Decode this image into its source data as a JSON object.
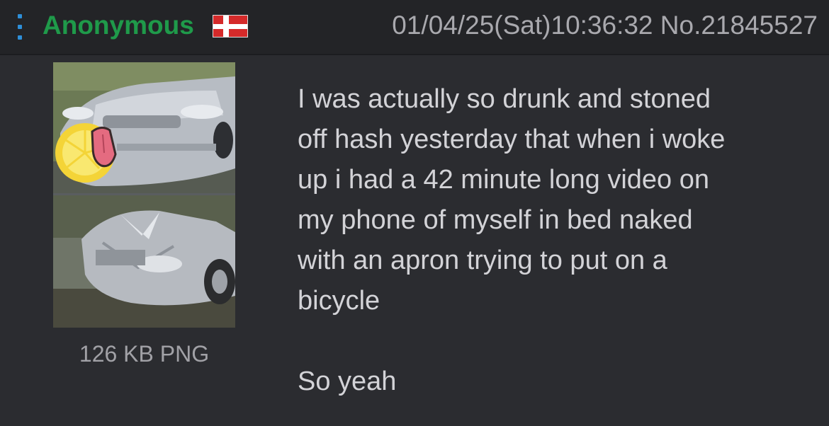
{
  "post": {
    "name": "Anonymous",
    "flag_icon": "denmark-flag-icon",
    "date": "01/04/25(Sat)10:36:32",
    "number": "No.21845527",
    "file_info": "126 KB PNG",
    "lines_para1": [
      "I was actually so drunk and stoned",
      "off hash yesterday that when i woke",
      "up i had a 42 minute long video on",
      "my phone of myself in bed naked",
      "with an apron trying to put on a",
      "bicycle"
    ],
    "line_para2": "So yeah"
  },
  "colors": {
    "background": "#2b2c30",
    "header_background": "#232427",
    "name_green": "#1f9a4a",
    "menu_blue": "#2e8fd8",
    "meta_gray": "#a9a9ae",
    "text": "#d3d3d7"
  }
}
